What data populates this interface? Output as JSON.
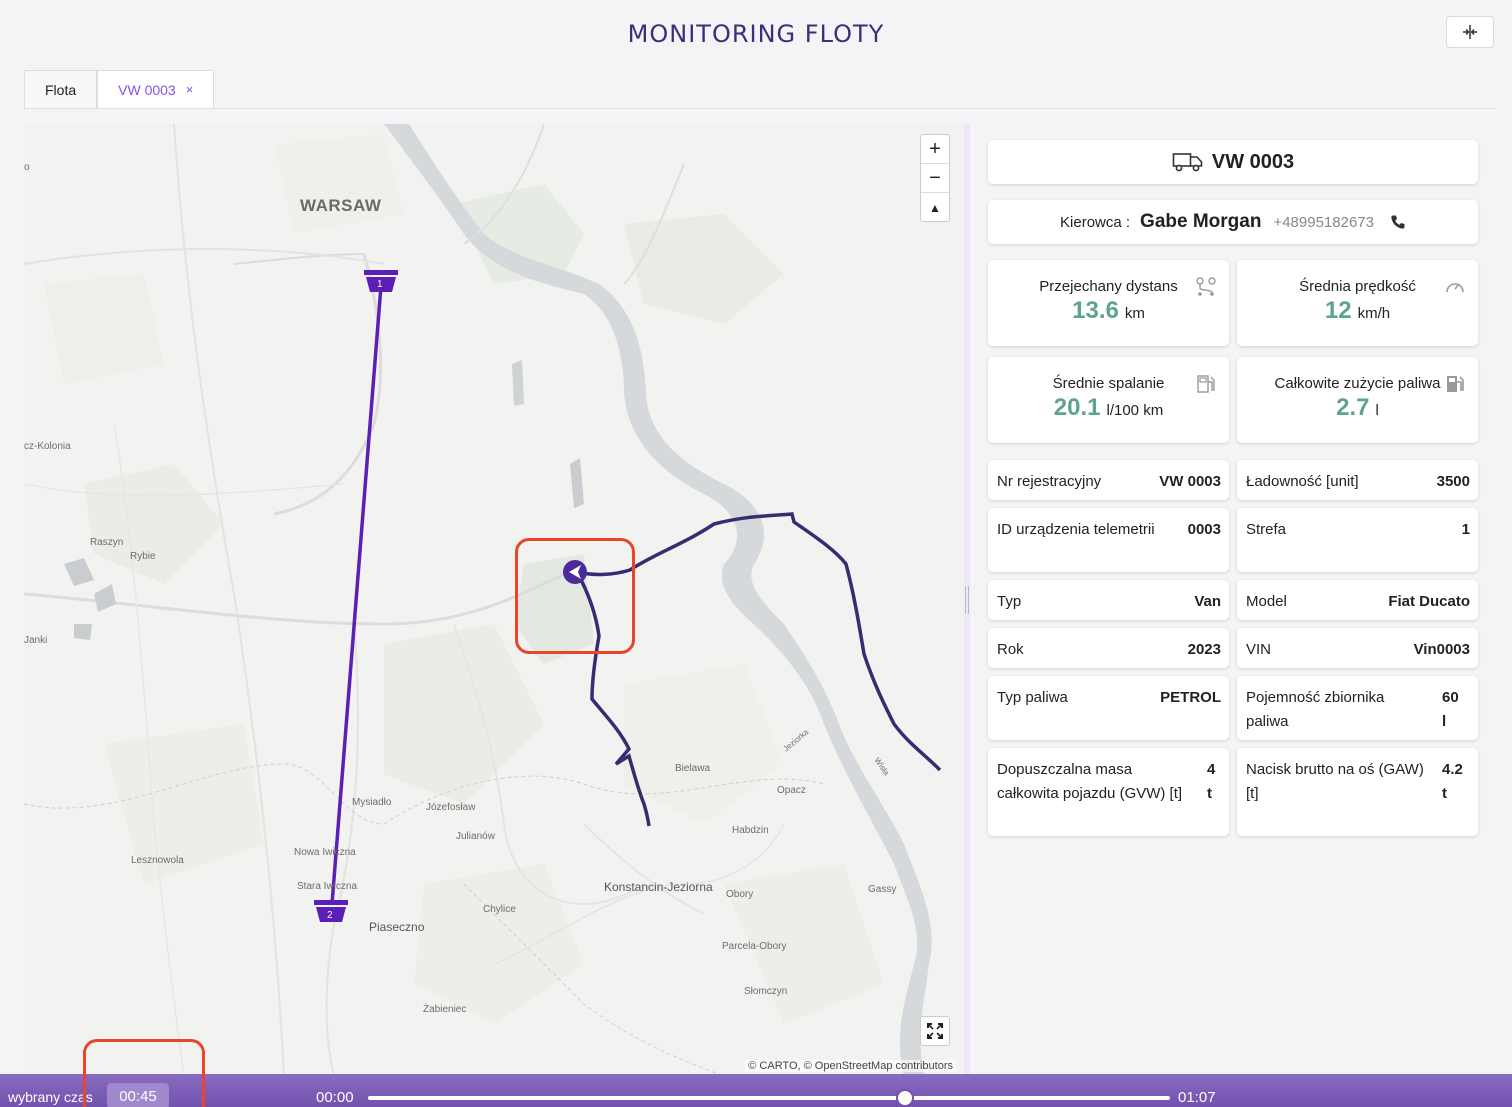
{
  "header": {
    "title": "MONITORING FLOTY",
    "layout_toggle_icon": "split-view-icon"
  },
  "tabs": [
    {
      "label": "Flota"
    },
    {
      "label": "VW 0003",
      "close": "×"
    }
  ],
  "map": {
    "places": [
      {
        "text": "WARSAW"
      },
      {
        "text": "Piaseczno"
      },
      {
        "text": "Konstancin-Jeziorna"
      },
      {
        "text": "Raszyn"
      },
      {
        "text": "Rybie"
      },
      {
        "text": "Janki"
      },
      {
        "text": "cz-Kolonia"
      },
      {
        "text": "Mysiadło"
      },
      {
        "text": "Józefosław"
      },
      {
        "text": "Julianów"
      },
      {
        "text": "Nowa Iwiczna"
      },
      {
        "text": "Stara Iwiczna"
      },
      {
        "text": "Lesznowola"
      },
      {
        "text": "Chylice"
      },
      {
        "text": "Bielawa"
      },
      {
        "text": "Opacz"
      },
      {
        "text": "Habdzin"
      },
      {
        "text": "Obory"
      },
      {
        "text": "Gassy"
      },
      {
        "text": "Parcela-Obory"
      },
      {
        "text": "Słomczyn"
      },
      {
        "text": "Żabieniec"
      },
      {
        "text": "Jeziorka"
      },
      {
        "text": "Wisła"
      },
      {
        "text": "o"
      }
    ],
    "markers": [
      {
        "number": "1"
      },
      {
        "number": "2"
      }
    ],
    "zoom_in": "+",
    "zoom_out": "−",
    "compass": "▲",
    "attribution": "© CARTO, © OpenStreetMap contributors",
    "route_color": "#3a2a72",
    "plan_line_color": "#5b1fb8"
  },
  "vehicle": {
    "name": "VW 0003",
    "icon": "truck-icon"
  },
  "driver": {
    "label": "Kierowca :",
    "name": "Gabe Morgan",
    "phone": "+48995182673",
    "icon": "phone-icon"
  },
  "stats": [
    {
      "label": "Przejechany dystans",
      "value": "13.6",
      "unit": "km",
      "icon": "route-icon"
    },
    {
      "label": "Średnia prędkość",
      "value": "12",
      "unit": "km/h",
      "icon": "speedometer-icon"
    },
    {
      "label": "Średnie spalanie",
      "value": "20.1",
      "unit": "l/100 km",
      "icon": "fuel-pump-icon"
    },
    {
      "label": "Całkowite zużycie paliwa",
      "value": "2.7",
      "unit": "l",
      "icon": "fuel-station-icon"
    }
  ],
  "details": [
    {
      "key": "Nr rejestracyjny",
      "value": "VW 0003"
    },
    {
      "key": "Ładowność [unit]",
      "value": "3500"
    },
    {
      "key": "ID urządzenia telemetrii",
      "value": "0003"
    },
    {
      "key": "Strefa",
      "value": "1"
    },
    {
      "key": "Typ",
      "value": "Van"
    },
    {
      "key": "Model",
      "value": "Fiat Ducato"
    },
    {
      "key": "Rok",
      "value": "2023"
    },
    {
      "key": "VIN",
      "value": "Vin0003"
    },
    {
      "key": "Typ paliwa",
      "value": "PETROL"
    },
    {
      "key": "Pojemność zbiornika paliwa",
      "value": "60 l"
    },
    {
      "key": "Dopuszczalna masa całkowita pojazdu (GVW) [t]",
      "value": "4 t"
    },
    {
      "key": "Nacisk brutto na oś (GAW) [t]",
      "value": "4.2 t"
    }
  ],
  "timeline": {
    "label": "wybrany czas",
    "selected": "00:45",
    "start": "00:00",
    "end": "01:07",
    "position_fraction": 0.67
  },
  "colors": {
    "accent": "#8a52e0",
    "value_green": "#5ea38f",
    "highlight": "#e9452a",
    "bar": "#7152ad"
  }
}
